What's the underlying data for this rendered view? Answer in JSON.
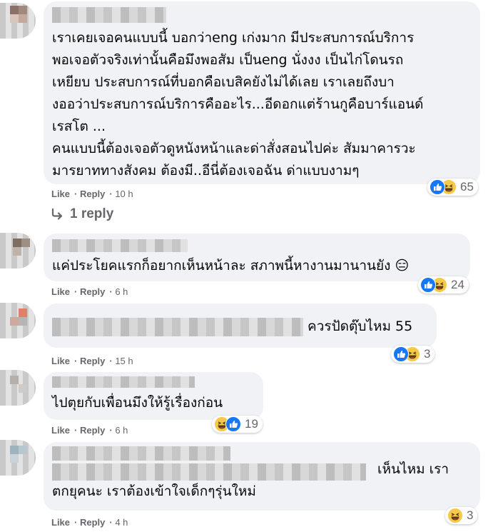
{
  "comments": [
    {
      "text": "เราเคยเจอคนแบบนี้ บอกว่าeng เก่งมาก มีประสบการณ์บริการ\nพอเจอตัวจริงเท่านั้นคือมึงพอสัม เป็นeng นั่งงง เป็นไก่โดนรถ\nเหยียบ ประสบการณ์ที่บอกคือเบสิคยังไม่ได้เลย เราเลยถึงบา\nงออว่าประสบการณ์บริการคืออะไร...อีดอกแต่ร้านกูคือบาร์แอนด์\nเรสโต ...\nคนแบบนี้ต้องเจอตัวดูหนังหน้าและด่าสั่งสอนไปค่ะ สัมมาคารวะ\nมารยาททางสังคม ต้องมี..อีนี่ต้องเจอฉัน ด่าแบบงามๆ",
      "like": "Like",
      "reply": "Reply",
      "time": "10 h",
      "reactions": "65"
    },
    {
      "text": "แค่ประโยคแรกก็อยากเห็นหน้าละ สภาพนี้หางานมานานยัง 😑",
      "like": "Like",
      "reply": "Reply",
      "time": "6 h",
      "reactions": "24"
    },
    {
      "text": "ควรปัดตุ๊บไหม 55",
      "like": "Like",
      "reply": "Reply",
      "time": "15 h",
      "reactions": "3"
    },
    {
      "text": "ไปตุยกับเพื่อนมึงให้รู้เรื่องก่อน",
      "like": "Like",
      "reply": "Reply",
      "time": "6 h",
      "reactions": "19"
    },
    {
      "text": "เห็นไหม เรา\nตกยุคนะ เราต้องเข้าใจเด็กๆรุ่นใหม่",
      "like": "Like",
      "reply": "Reply",
      "time": "4 h",
      "reactions": "3"
    }
  ],
  "replies_link": "1 reply",
  "colors": {
    "like_blue": "#1877f2",
    "haha_yellow": "#f7c94b",
    "bubble": "#f0f2f5",
    "meta_gray": "#65676b"
  }
}
